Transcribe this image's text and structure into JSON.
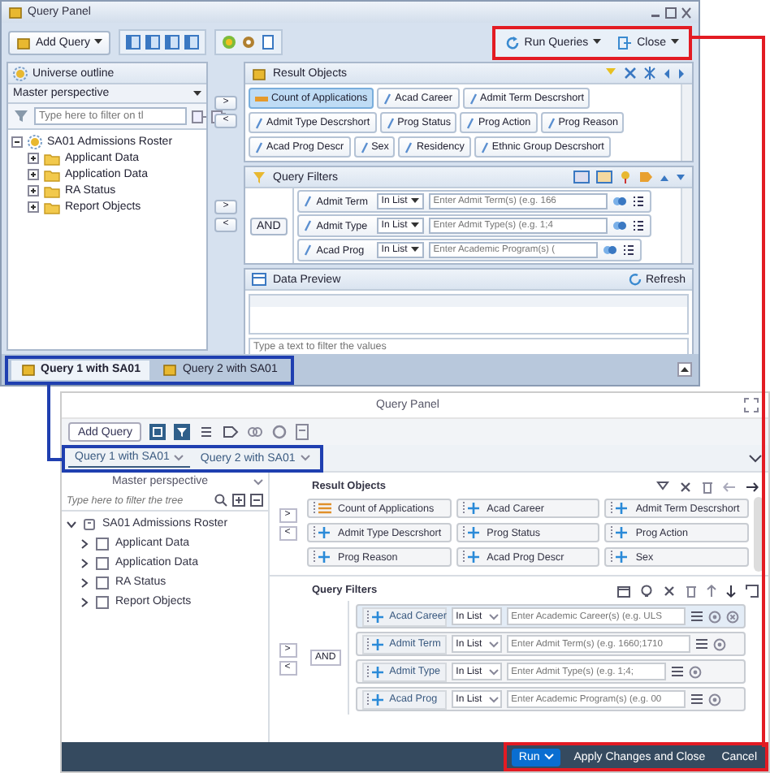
{
  "top_window": {
    "title": "Query Panel",
    "add_query": "Add Query",
    "actions": [
      {
        "kind": "run",
        "label": "Run Queries"
      },
      {
        "kind": "close",
        "label": "Close"
      }
    ],
    "outline": {
      "title": "Universe outline",
      "perspective": "Master perspective",
      "filter_placeholder": "Type here to filter on tl",
      "tree": [
        {
          "label": "SA01 Admissions Roster",
          "expanded": true,
          "children": [
            {
              "label": "Applicant Data",
              "expanded": false
            },
            {
              "label": "Application Data",
              "expanded": false
            },
            {
              "label": "RA Status",
              "expanded": false
            },
            {
              "label": "Report Objects",
              "expanded": false
            }
          ]
        }
      ]
    },
    "result_objects": {
      "title": "Result Objects",
      "move_buttons": [
        ">",
        "<"
      ],
      "chips": [
        {
          "label": "Count of Applications",
          "kind": "measure",
          "selected": true
        },
        {
          "label": "Acad Career",
          "kind": "dimension",
          "selected": false
        },
        {
          "label": "Admit Term Descrshort",
          "kind": "dimension",
          "selected": false
        },
        {
          "label": "Admit Type Descrshort",
          "kind": "dimension",
          "selected": false
        },
        {
          "label": "Prog Status",
          "kind": "dimension",
          "selected": false
        },
        {
          "label": "Prog Action",
          "kind": "dimension",
          "selected": false
        },
        {
          "label": "Prog Reason",
          "kind": "dimension",
          "selected": false
        },
        {
          "label": "Acad Prog Descr",
          "kind": "dimension",
          "selected": false
        },
        {
          "label": "Sex",
          "kind": "dimension",
          "selected": false
        },
        {
          "label": "Residency",
          "kind": "dimension",
          "selected": false
        },
        {
          "label": "Ethnic Group Descrshort",
          "kind": "dimension",
          "selected": false
        }
      ]
    },
    "query_filters": {
      "title": "Query Filters",
      "move_buttons": [
        ">",
        "<"
      ],
      "operator": "AND",
      "filters": [
        {
          "object": "Admit Term",
          "operator": "In List",
          "placeholder": "Enter Admit Term(s) (e.g. 166"
        },
        {
          "object": "Admit Type",
          "operator": "In List",
          "placeholder": "Enter Admit Type(s) (e.g. 1;4"
        },
        {
          "object": "Acad Prog",
          "operator": "In List",
          "placeholder": "Enter Academic Program(s) ("
        }
      ]
    },
    "data_preview": {
      "title": "Data Preview",
      "refresh": "Refresh",
      "filter_placeholder": "Type a text to filter the values"
    },
    "tabs": [
      {
        "label": "Query 1 with SA01",
        "selected": true
      },
      {
        "label": "Query 2 with SA01",
        "selected": false
      }
    ]
  },
  "bottom_window": {
    "title": "Query Panel",
    "add_query": "Add Query",
    "tabs": [
      {
        "label": "Query 1 with SA01",
        "selected": true
      },
      {
        "label": "Query 2 with SA01",
        "selected": false
      }
    ],
    "outline": {
      "perspective": "Master perspective",
      "filter_placeholder": "Type here to filter the tree",
      "tree": [
        {
          "label": "SA01 Admissions Roster",
          "expanded": true,
          "children": [
            {
              "label": "Applicant Data",
              "expanded": false
            },
            {
              "label": "Application Data",
              "expanded": false
            },
            {
              "label": "RA Status",
              "expanded": false
            },
            {
              "label": "Report Objects",
              "expanded": false
            }
          ]
        }
      ]
    },
    "result_objects": {
      "title": "Result Objects",
      "move_buttons": [
        ">",
        "<"
      ],
      "chips": [
        {
          "label": "Count of Applications",
          "kind": "measure",
          "selected": false
        },
        {
          "label": "Acad Career",
          "kind": "dimension",
          "selected": false
        },
        {
          "label": "Admit Term Descrshort",
          "kind": "dimension",
          "selected": false
        },
        {
          "label": "Admit Type Descrshort",
          "kind": "dimension",
          "selected": false
        },
        {
          "label": "Prog Status",
          "kind": "dimension",
          "selected": false
        },
        {
          "label": "Prog Action",
          "kind": "dimension",
          "selected": false
        },
        {
          "label": "Prog Reason",
          "kind": "dimension",
          "selected": false
        },
        {
          "label": "Acad Prog Descr",
          "kind": "dimension",
          "selected": false
        },
        {
          "label": "Sex",
          "kind": "dimension",
          "selected": false
        }
      ]
    },
    "query_filters": {
      "title": "Query Filters",
      "move_buttons": [
        ">",
        "<"
      ],
      "operator": "AND",
      "filters": [
        {
          "object": "Acad Career",
          "operator": "In List",
          "placeholder": "Enter Academic Career(s) (e.g. ULS",
          "selected": true
        },
        {
          "object": "Admit Term",
          "operator": "In List",
          "placeholder": "Enter Admit Term(s) (e.g. 1660;1710",
          "selected": false
        },
        {
          "object": "Admit Type",
          "operator": "In List",
          "placeholder": "Enter Admit Type(s) (e.g. 1;4;",
          "selected": false
        },
        {
          "object": "Acad Prog",
          "operator": "In List",
          "placeholder": "Enter Academic Program(s) (e.g. 00",
          "selected": false
        }
      ]
    },
    "footer": [
      {
        "kind": "run",
        "label": "Run"
      },
      {
        "kind": "link",
        "label": "Apply Changes and Close"
      },
      {
        "kind": "link",
        "label": "Cancel"
      }
    ]
  }
}
